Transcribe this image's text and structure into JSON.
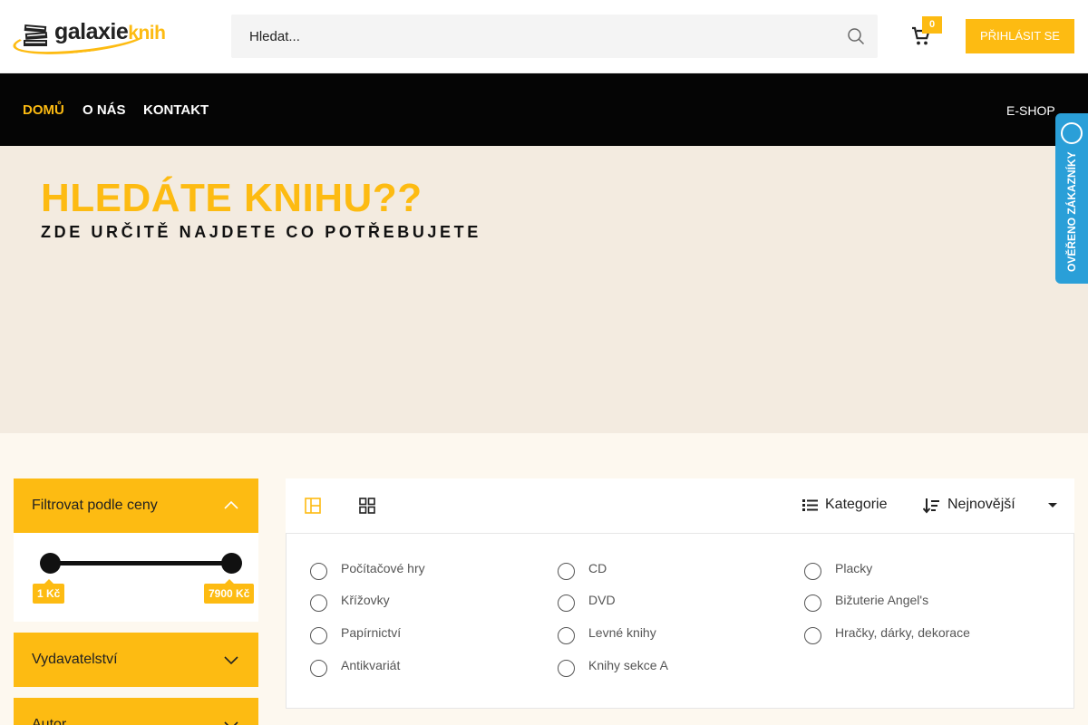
{
  "header": {
    "logo": {
      "main": "galaxie",
      "accent": "knih"
    },
    "search": {
      "placeholder": "Hledat..."
    },
    "cart_count": "0",
    "login_label": "PŘIHLÁSIT SE"
  },
  "nav": {
    "items": [
      {
        "label": "DOMŮ",
        "active": true
      },
      {
        "label": "O NÁS",
        "active": false
      },
      {
        "label": "KONTAKT",
        "active": false
      }
    ],
    "eshop_label": "E-SHOP"
  },
  "hero": {
    "title": "HLEDÁTE KNIHU??",
    "subtitle": "ZDE URČITĚ NAJDETE CO POTŘEBUJETE"
  },
  "verified_badge": {
    "label": "OVĚŘENO ZÁKAZNÍKY"
  },
  "filters": {
    "price": {
      "label": "Filtrovat podle ceny",
      "min": "1 Kč",
      "max": "7900 Kč"
    },
    "publisher": {
      "label": "Vydavatelství"
    },
    "author": {
      "label": "Autor"
    }
  },
  "toolbar": {
    "category_label": "Kategorie",
    "sort_label": "Nejnovější"
  },
  "categories": [
    "Počítačové hry",
    "CD",
    "Placky",
    "Křížovky",
    "DVD",
    "Bižuterie Angel's",
    "Papírnictví",
    "Levné knihy",
    "Hračky, dárky, dekorace",
    "Antikvariát",
    "Knihy sekce A"
  ],
  "colors": {
    "accent": "#fdbb12",
    "nav_bg": "#050505",
    "hero_bg": "#f3ebe0",
    "badge_blue": "#2a9fd8"
  }
}
